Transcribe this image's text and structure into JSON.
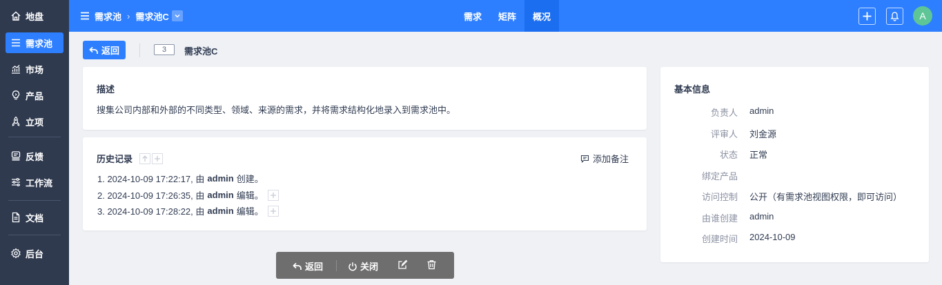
{
  "sidebar": {
    "items": [
      {
        "label": "地盘",
        "icon": "home-icon",
        "active": false
      },
      {
        "label": "需求池",
        "icon": "menu-lines-icon",
        "active": true
      },
      {
        "label": "市场",
        "icon": "chart-icon",
        "active": false
      },
      {
        "label": "产品",
        "icon": "lightbulb-icon",
        "active": false
      },
      {
        "label": "立项",
        "icon": "rocket-icon",
        "active": false
      },
      {
        "label": "反馈",
        "icon": "feedback-icon",
        "active": false
      },
      {
        "label": "工作流",
        "icon": "workflow-icon",
        "active": false
      },
      {
        "label": "文档",
        "icon": "document-icon",
        "active": false
      },
      {
        "label": "后台",
        "icon": "gear-icon",
        "active": false
      }
    ]
  },
  "header": {
    "breadcrumb_root": "需求池",
    "breadcrumb_current": "需求池C",
    "tabs": [
      {
        "label": "需求",
        "active": false
      },
      {
        "label": "矩阵",
        "active": false
      },
      {
        "label": "概况",
        "active": true
      }
    ],
    "avatar_letter": "A",
    "colors": {
      "primary": "#2e7fff",
      "sidebar": "#2f3a4f",
      "avatar": "#5dc596"
    }
  },
  "toolbar": {
    "back_label": "返回",
    "id": "3",
    "title": "需求池C"
  },
  "description": {
    "title": "描述",
    "text": "搜集公司内部和外部的不同类型、领域、来源的需求，并将需求结构化地录入到需求池中。"
  },
  "history": {
    "title": "历史记录",
    "add_note_label": "添加备注",
    "entries": [
      {
        "prefix": "1. 2024-10-09 17:22:17, 由",
        "user": "admin",
        "action": "创建。",
        "expandable": false
      },
      {
        "prefix": "2. 2024-10-09 17:26:35, 由",
        "user": "admin",
        "action": "编辑。",
        "expandable": true
      },
      {
        "prefix": "3. 2024-10-09 17:28:22, 由",
        "user": "admin",
        "action": "编辑。",
        "expandable": true
      }
    ]
  },
  "basic_info": {
    "title": "基本信息",
    "rows": [
      {
        "label": "负责人",
        "value": "admin"
      },
      {
        "label": "评审人",
        "value": "刘金源"
      },
      {
        "label": "状态",
        "value": "正常"
      },
      {
        "label": "绑定产品",
        "value": ""
      },
      {
        "label": "访问控制",
        "value": "公开（有需求池视图权限，即可访问）"
      },
      {
        "label": "由谁创建",
        "value": "admin"
      },
      {
        "label": "创建时间",
        "value": "2024-10-09"
      }
    ]
  },
  "bottom_bar": {
    "back_label": "返回",
    "close_label": "关闭"
  }
}
